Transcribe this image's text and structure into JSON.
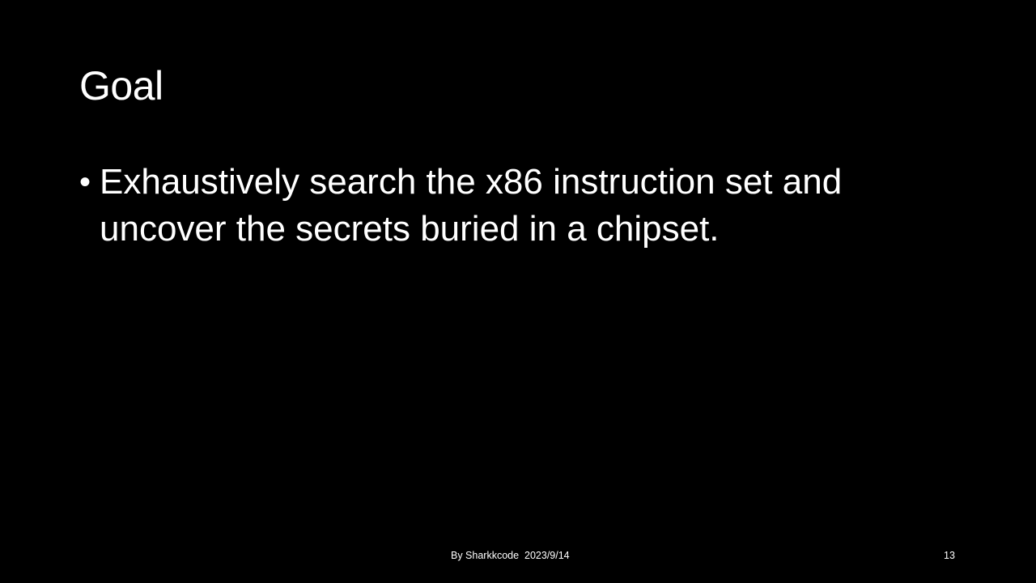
{
  "slide": {
    "title": "Goal",
    "bullets": [
      {
        "marker": "•",
        "text": "Exhaustively search the x86 instruction set and uncover the secrets buried in a chipset."
      }
    ],
    "footer": "By Sharkkcode  2023/9/14",
    "page_number": "13"
  },
  "colors": {
    "background": "#000000",
    "text": "#ffffff"
  }
}
